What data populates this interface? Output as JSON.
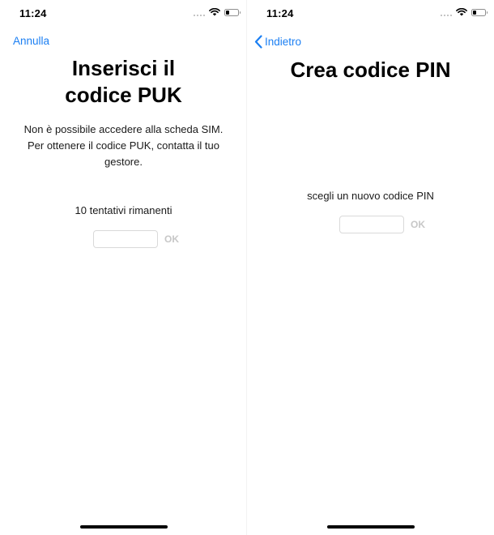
{
  "puk_screen": {
    "status_time": "11:24",
    "battery_level": 0.3,
    "nav_label": "Annulla",
    "title_line1": "Inserisci il",
    "title_line2": "codice PUK",
    "description_line1": "Non è possibile accedere alla scheda SIM.",
    "description_line2": "Per ottenere il codice PUK, contatta il tuo",
    "description_line3": "gestore.",
    "attempts_text": "10 tentativi rimanenti",
    "input_value": "",
    "ok_label": "OK"
  },
  "pin_screen": {
    "status_time": "11:24",
    "battery_level": 0.3,
    "nav_label": "Indietro",
    "title": "Crea codice PIN",
    "prompt_text": "scegli un nuovo codice PIN",
    "input_value": "",
    "ok_label": "OK"
  },
  "colors": {
    "link": "#1b7ff3",
    "disabled_text": "#c7c7c7",
    "input_border": "#d9d9d9"
  }
}
